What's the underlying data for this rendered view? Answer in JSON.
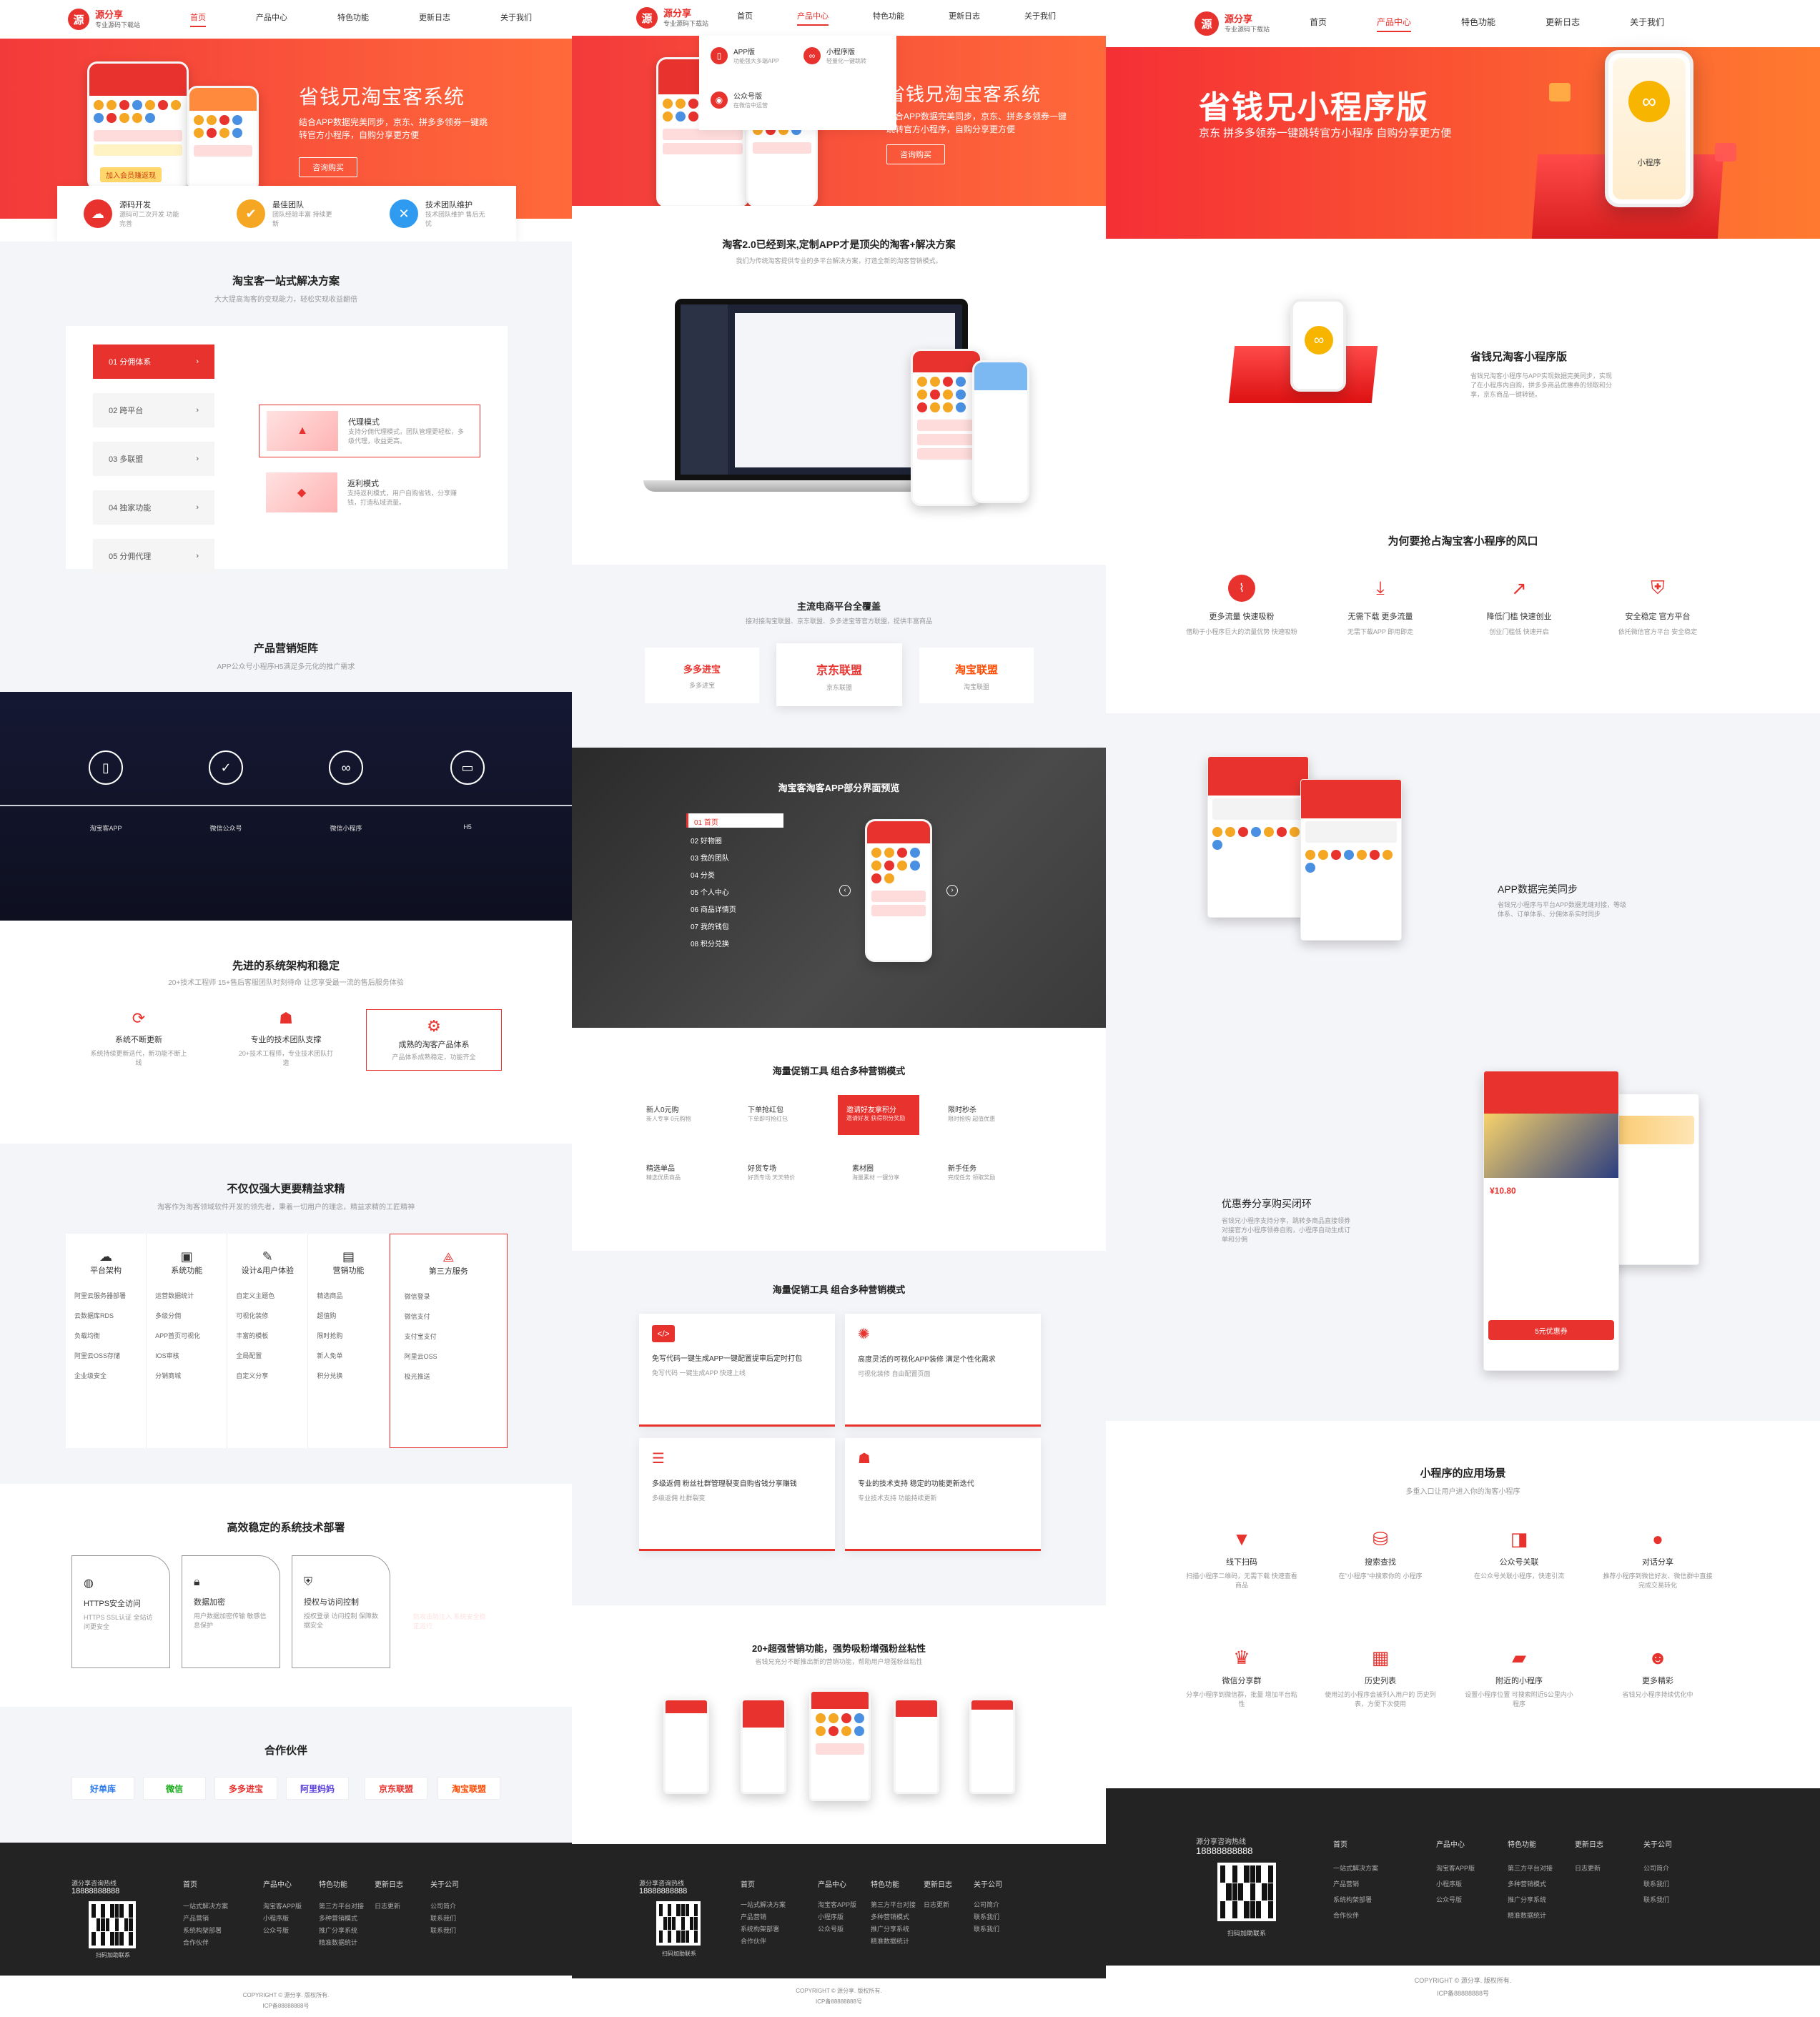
{
  "brand": {
    "name": "源分享",
    "slogan": "专业源码下载站"
  },
  "nav": [
    "首页",
    "产品中心",
    "特色功能",
    "更新日志",
    "关于我们"
  ],
  "dropdown": [
    {
      "title": "APP版",
      "desc": "功能强大多端APP"
    },
    {
      "title": "小程序版",
      "desc": "轻量化一键跳转"
    },
    {
      "title": "公众号版",
      "desc": "在微信中运营"
    }
  ],
  "p1": {
    "hero_title": "省钱兄淘宝客系统",
    "hero_desc": "结合APP数据完美同步，京东、拼多多领券一键跳转官方小程序，自购分享更方便",
    "hero_btn": "咨询购买",
    "hero_badge": "加入会员赚返现",
    "features": [
      {
        "title": "源码开发",
        "desc": "源码可二次开发 功能完善"
      },
      {
        "title": "最佳团队",
        "desc": "团队经验丰富 持续更新"
      },
      {
        "title": "技术团队维护",
        "desc": "技术团队维护 售后无忧"
      }
    ],
    "solution_title": "淘宝客一站式解决方案",
    "solution_sub": "大大提高淘客的变现能力，轻松实现收益翻倍",
    "solution_tabs": [
      "01  分佣体系",
      "02  跨平台",
      "03  多联盟",
      "04  独家功能",
      "05  分佣代理"
    ],
    "modes": [
      {
        "title": "代理模式",
        "desc": "支持分佣代理模式，团队管理更轻松，多级代理，收益更高。"
      },
      {
        "title": "返利模式",
        "desc": "支持返利模式，用户自购省钱，分享赚钱，打造私域流量。"
      }
    ],
    "matrix_title": "产品营销矩阵",
    "matrix_sub": "APP公众号小程序H5满足多元化的推广需求",
    "matrix_items": [
      "淘宝客APP",
      "微信公众号",
      "微信小程序",
      "H5"
    ],
    "arch_title": "先进的系统架构和稳定",
    "arch_sub": "20+技术工程师 15+售后客服团队时刻待命 让您享受最一流的售后服务体验",
    "arch_cards": [
      {
        "title": "系统不断更新",
        "desc": "系统持续更新迭代，新功能不断上线"
      },
      {
        "title": "专业的技术团队支撑",
        "desc": "20+技术工程师，专业技术团队打造"
      },
      {
        "title": "成熟的淘客产品体系",
        "desc": "产品体系成熟稳定，功能齐全"
      }
    ],
    "pro_title": "不仅仅强大更要精益求精",
    "pro_sub": "淘客作为淘客领域软件开发的领先者，秉着一切用户的理念，精益求精的工匠精神",
    "pro_cols": [
      {
        "title": "平台架构",
        "items": [
          "阿里云服务器部署",
          "云数据库RDS",
          "负载均衡",
          "阿里云OSS存储",
          "企业级安全"
        ]
      },
      {
        "title": "系统功能",
        "items": [
          "运营数据统计",
          "多级分佣",
          "APP首页可视化",
          "IOS审核",
          "分销商城"
        ]
      },
      {
        "title": "设计&用户体验",
        "items": [
          "自定义主题色",
          "可视化装修",
          "丰富的模板",
          "全局配置",
          "自定义分享"
        ]
      },
      {
        "title": "营销功能",
        "items": [
          "精选商品",
          "超值购",
          "限时抢购",
          "新人免单",
          "积分兑换"
        ]
      },
      {
        "title": "第三方服务",
        "items": [
          "微信登录",
          "微信支付",
          "支付宝支付",
          "阿里云OSS",
          "极光推送"
        ]
      }
    ],
    "sec_title": "高效稳定的系统技术部署",
    "sec_cards": [
      {
        "title": "HTTPS安全访问",
        "desc": "HTTPS SSL认证 全站访问更安全"
      },
      {
        "title": "数据加密",
        "desc": "用户数据加密传输 敏感信息保护"
      },
      {
        "title": "授权与访问控制",
        "desc": "授权登录 访问控制 保障数据安全"
      },
      {
        "title": "防攻击/注入",
        "desc": "防攻击防注入 系统安全稳定运行"
      }
    ],
    "partner_title": "合作伙伴",
    "partners": [
      "好单库",
      "微信",
      "多多进宝",
      "阿里妈妈",
      "京东联盟",
      "淘宝联盟"
    ]
  },
  "p2": {
    "hero_title": "省钱兄淘宝客系统",
    "hero_desc": "结合APP数据完美同步，京东、拼多多领券一键跳转官方小程序，自购分享更方便",
    "hero_btn": "咨询购买",
    "custom_title": "淘客2.0已经到来,定制APP才是顶尖的淘客+解决方案",
    "custom_sub": "我们为传统淘客提供专业的多平台解决方案，打造全新的淘客营销模式。",
    "platform_title": "主流电商平台全覆盖",
    "platform_sub": "接对接淘宝联盟、京东联盟、多多进宝等官方联盟，提供丰富商品",
    "platforms": [
      {
        "name": "多多进宝",
        "desc": "多多进宝"
      },
      {
        "name": "京东联盟",
        "desc": "京东联盟"
      },
      {
        "name": "淘宝联盟",
        "desc": "淘宝联盟"
      }
    ],
    "preview_title": "淘宝客淘客APP部分界面预览",
    "preview_list": [
      "01  首页",
      "02  好物圈",
      "03  我的团队",
      "04  分类",
      "05  个人中心",
      "06  商品详情页",
      "07  我的钱包",
      "08  积分兑换"
    ],
    "tools_title": "海量促销工具 组合多种营销模式",
    "tools": [
      {
        "t": "新人0元购",
        "d": "新人专享 0元购物"
      },
      {
        "t": "下单抢红包",
        "d": "下单即可抢红包"
      },
      {
        "t": "邀请好友拿积分",
        "d": "邀请好友 获得积分奖励"
      },
      {
        "t": "限时秒杀",
        "d": "限时抢购 超值优惠"
      },
      {
        "t": "精选单品",
        "d": "精选优质商品"
      },
      {
        "t": "好货专场",
        "d": "好货专场 天天特价"
      },
      {
        "t": "素材圈",
        "d": "海量素材 一键分享"
      },
      {
        "t": "新手任务",
        "d": "完成任务 领取奖励"
      }
    ],
    "tools2_title": "海量促销工具 组合多种营销模式",
    "tools2": [
      {
        "t": "免写代码一键生成APP一键配置提审后定时打包",
        "d": "免写代码 一键生成APP 快速上线"
      },
      {
        "t": "高度灵活的可视化APP装修 满足个性化需求",
        "d": "可视化装修 自由配置页面"
      },
      {
        "t": "多级返佣 粉丝社群管理裂变自购省钱分享赚钱",
        "d": "多级返佣 社群裂变"
      },
      {
        "t": "专业的技术支持 稳定的功能更新迭代",
        "d": "专业技术支持 功能持续更新"
      }
    ],
    "more_title": "20+超强营销功能，强势吸粉增强粉丝粘性",
    "more_sub": "省钱兄充分不断推出新的营销功能，帮助用户增强粉丝粘性"
  },
  "p3": {
    "hero_title": "省钱兄小程序版",
    "hero_desc": "京东 拼多多领券一键跳转官方小程序 自购分享更方便",
    "hero_phone_label": "小程序",
    "mini_title": "省钱兄淘客小程序版",
    "mini_desc": "省钱兄淘客小程序与APP实现数据完美同步，实现了在小程序内自购，拼多多商品优惠券的领取和分享，京东商品一键转链。",
    "why_title": "为何要抢占淘宝客小程序的风口",
    "why": [
      {
        "t": "更多流量 快速吸粉",
        "d": "借助于小程序巨大的流量优势 快速吸粉"
      },
      {
        "t": "无需下载 更多流量",
        "d": "无需下载APP 即用即走"
      },
      {
        "t": "降低门槛 快速创业",
        "d": "创业门槛低 快速开启"
      },
      {
        "t": "安全稳定 官方平台",
        "d": "依托微信官方平台 安全稳定"
      }
    ],
    "sync_title": "APP数据完美同步",
    "sync_desc": "省钱兄小程序与平台APP数据无缝对接，等级体系、订单体系、分佣体系实时同步",
    "share_title": "优惠券分享购买闭环",
    "share_desc": "省钱兄小程序支持分享，跳转多商品直接领券对接官方小程序领券自购，小程序自动生成订单和分佣",
    "share_price": "¥10.80",
    "share_btn": "5元优惠券",
    "scene_title": "小程序的应用场景",
    "scene_sub": "多重入口让用户进入你的淘客小程序",
    "scenes": [
      {
        "t": "线下扫码",
        "d": "扫描小程序二维码，无需下载 快速查看商品"
      },
      {
        "t": "搜索查找",
        "d": "在\"小程序\"中搜索你的 小程序"
      },
      {
        "t": "公众号关联",
        "d": "在公众号关联小程序，快速引流"
      },
      {
        "t": "对话分享",
        "d": "推荐小程序到微信好友、微信群中直接完成交易转化"
      },
      {
        "t": "微信分享群",
        "d": "分享小程序到微信群，批量 增加平台粘性"
      },
      {
        "t": "历史列表",
        "d": "使用过的小程序会被列入用户的 历史列表，方便下次使用"
      },
      {
        "t": "附近的小程序",
        "d": "设置小程序位置 可搜索附近5公里内小程序"
      },
      {
        "t": "更多精彩",
        "d": "省钱兄小程序持续优化中"
      }
    ]
  },
  "footer": {
    "hotline_label": "源分享咨询热线",
    "hotline": "18888888888",
    "qr_label": "扫码加助联系",
    "cols": [
      {
        "h": "首页",
        "items": [
          "一站式解决方案",
          "产品营销",
          "系统构架部署",
          "合作伙伴"
        ]
      },
      {
        "h": "产品中心",
        "items": [
          "淘宝客APP版",
          "小程序版",
          "公众号版"
        ]
      },
      {
        "h": "特色功能",
        "items": [
          "第三方平台对接",
          "多种营销模式",
          "推广分享系统",
          "精准数据统计"
        ]
      },
      {
        "h": "更新日志",
        "items": [
          "日志更新"
        ]
      },
      {
        "h": "关于公司",
        "items": [
          "公司简介",
          "联系我们",
          "联系我们"
        ]
      }
    ],
    "copyright": "COPYRIGHT © 源分享. 版权所有.",
    "icp": "ICP备88888888号"
  },
  "colors": {
    "accent": "#e8322e",
    "dark": "#232323"
  }
}
